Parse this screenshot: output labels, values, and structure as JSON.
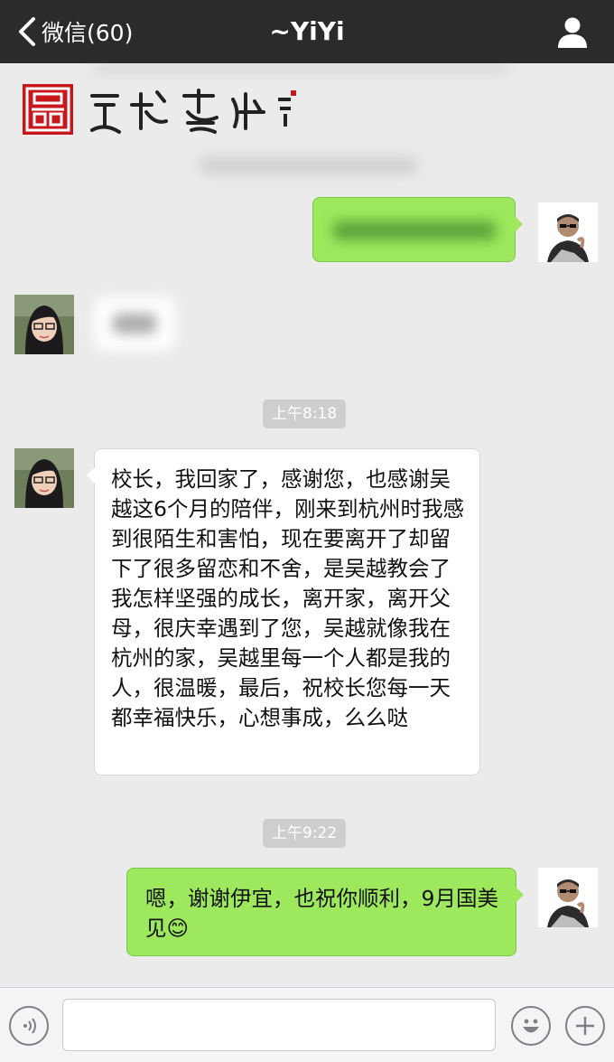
{
  "navbar": {
    "back_label": "微信(60)",
    "title": "~YiYi"
  },
  "brand_banner": {
    "seal_text": "吴越",
    "calligraphy_text": "吴越藝术",
    "brand_color": "#c8161d"
  },
  "messages": [
    {
      "time": "上午8:18"
    },
    {
      "sender": "YiYi",
      "text": "校长，我回家了，感谢您，也感谢吴越这6个月的陪伴，刚来到杭州时我感到很陌生和害怕，现在要离开了却留下了很多留恋和不舍，是吴越教会了我怎样坚强的成长，离开家，离开父母，很庆幸遇到了您，吴越就像我在杭州的家，吴越里每一个人都是我的人，很温暖，最后，祝校长您每一天都幸福快乐，心想事成，么么哒"
    },
    {
      "time": "上午9:22"
    },
    {
      "sender": "self",
      "text": "嗯，谢谢伊宜，也祝你顺利，9月国美见😊"
    }
  ],
  "colors": {
    "navbar_bg": "#2b2b2e",
    "chat_bg": "#ebebeb",
    "outgoing_bubble": "#9de85c",
    "incoming_bubble": "#ffffff"
  },
  "icons": {
    "back": "chevron-left-icon",
    "profile": "person-icon",
    "voice": "voice-icon",
    "emoji": "smiley-icon",
    "more": "plus-icon"
  }
}
